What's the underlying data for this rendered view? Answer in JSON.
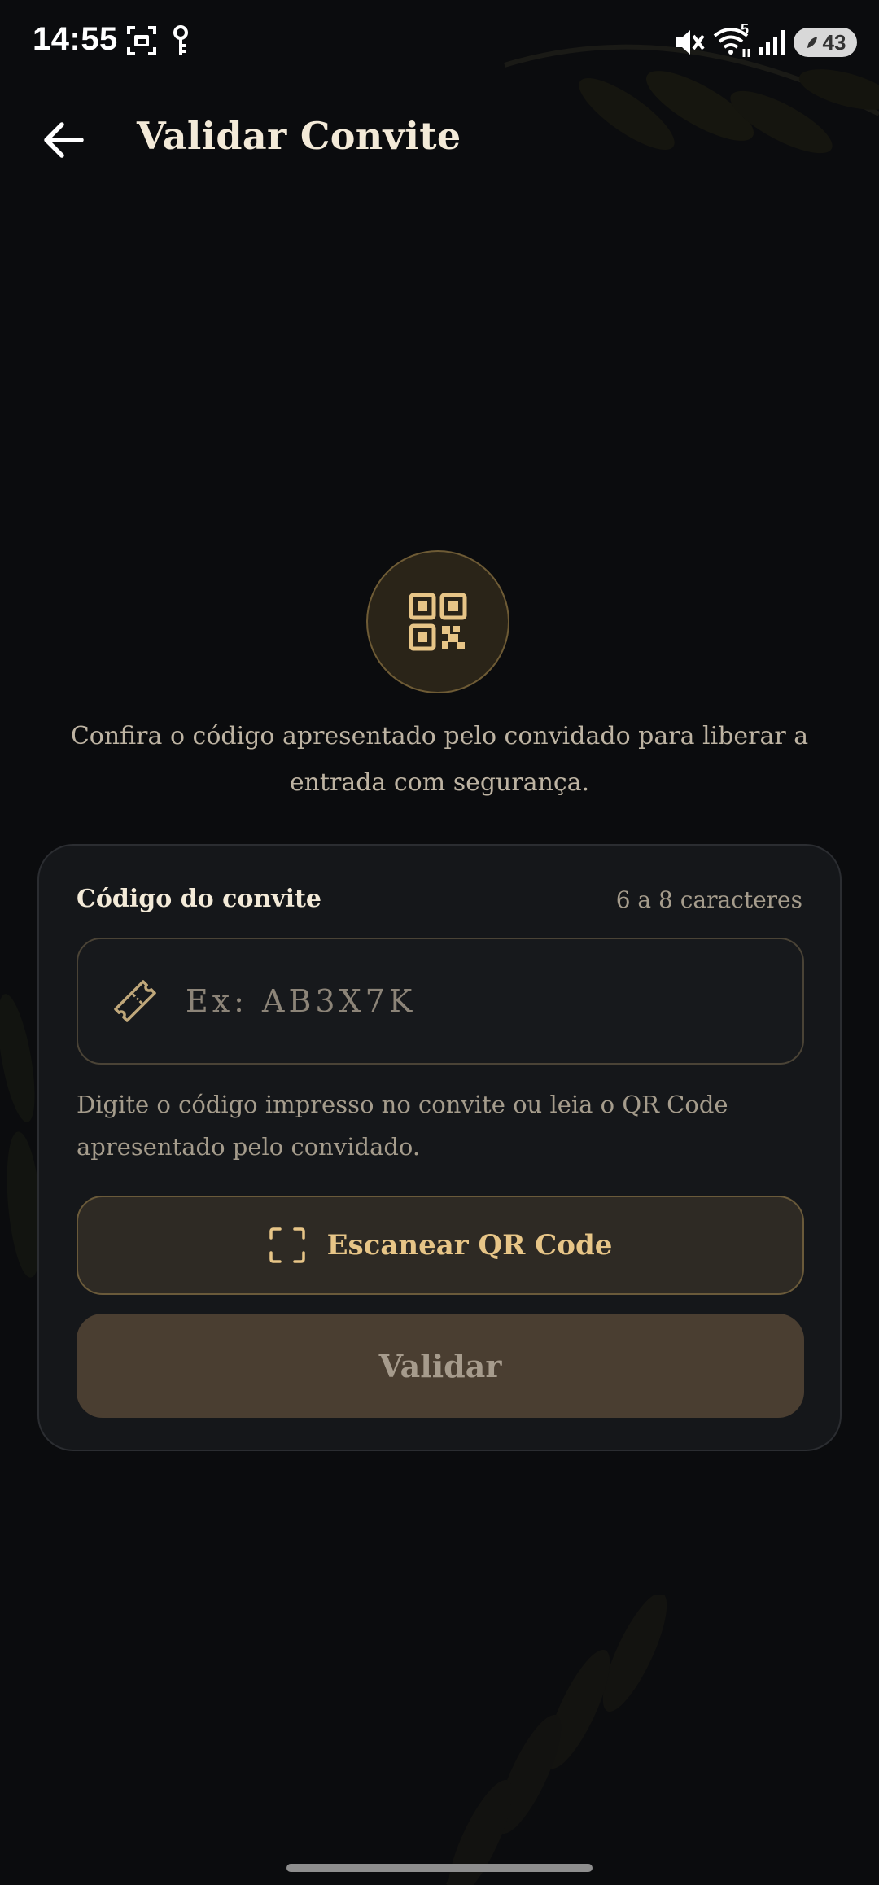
{
  "status_bar": {
    "time": "14:55",
    "network_label": "5",
    "battery_level": "43",
    "icons": [
      "screenshot-icon",
      "key-icon",
      "mute-icon",
      "wifi-icon",
      "signal-icon",
      "battery-icon"
    ]
  },
  "header": {
    "title": "Validar Convite",
    "back_icon": "arrow-left-icon"
  },
  "hero": {
    "icon": "qr-code-icon",
    "description": "Confira o código apresentado pelo convidado para liberar a entrada com segurança."
  },
  "form": {
    "code_label": "Código do convite",
    "code_hint": "6 a 8 caracteres",
    "code_value": "",
    "code_placeholder": "Ex: AB3X7K",
    "field_icon": "ticket-icon",
    "helper_text": "Digite o código impresso no convite ou leia o QR Code apresentado pelo convidado.",
    "scan_label": "Escanear QR Code",
    "scan_icon": "scan-frame-icon",
    "validate_label": "Validar"
  },
  "colors": {
    "background": "#0b0c0e",
    "card": "#15171a",
    "accent_gold": "#e7c587",
    "text_primary": "#f3ead8",
    "text_muted": "#a59c8c",
    "validate_disabled": "#4a3e31"
  }
}
